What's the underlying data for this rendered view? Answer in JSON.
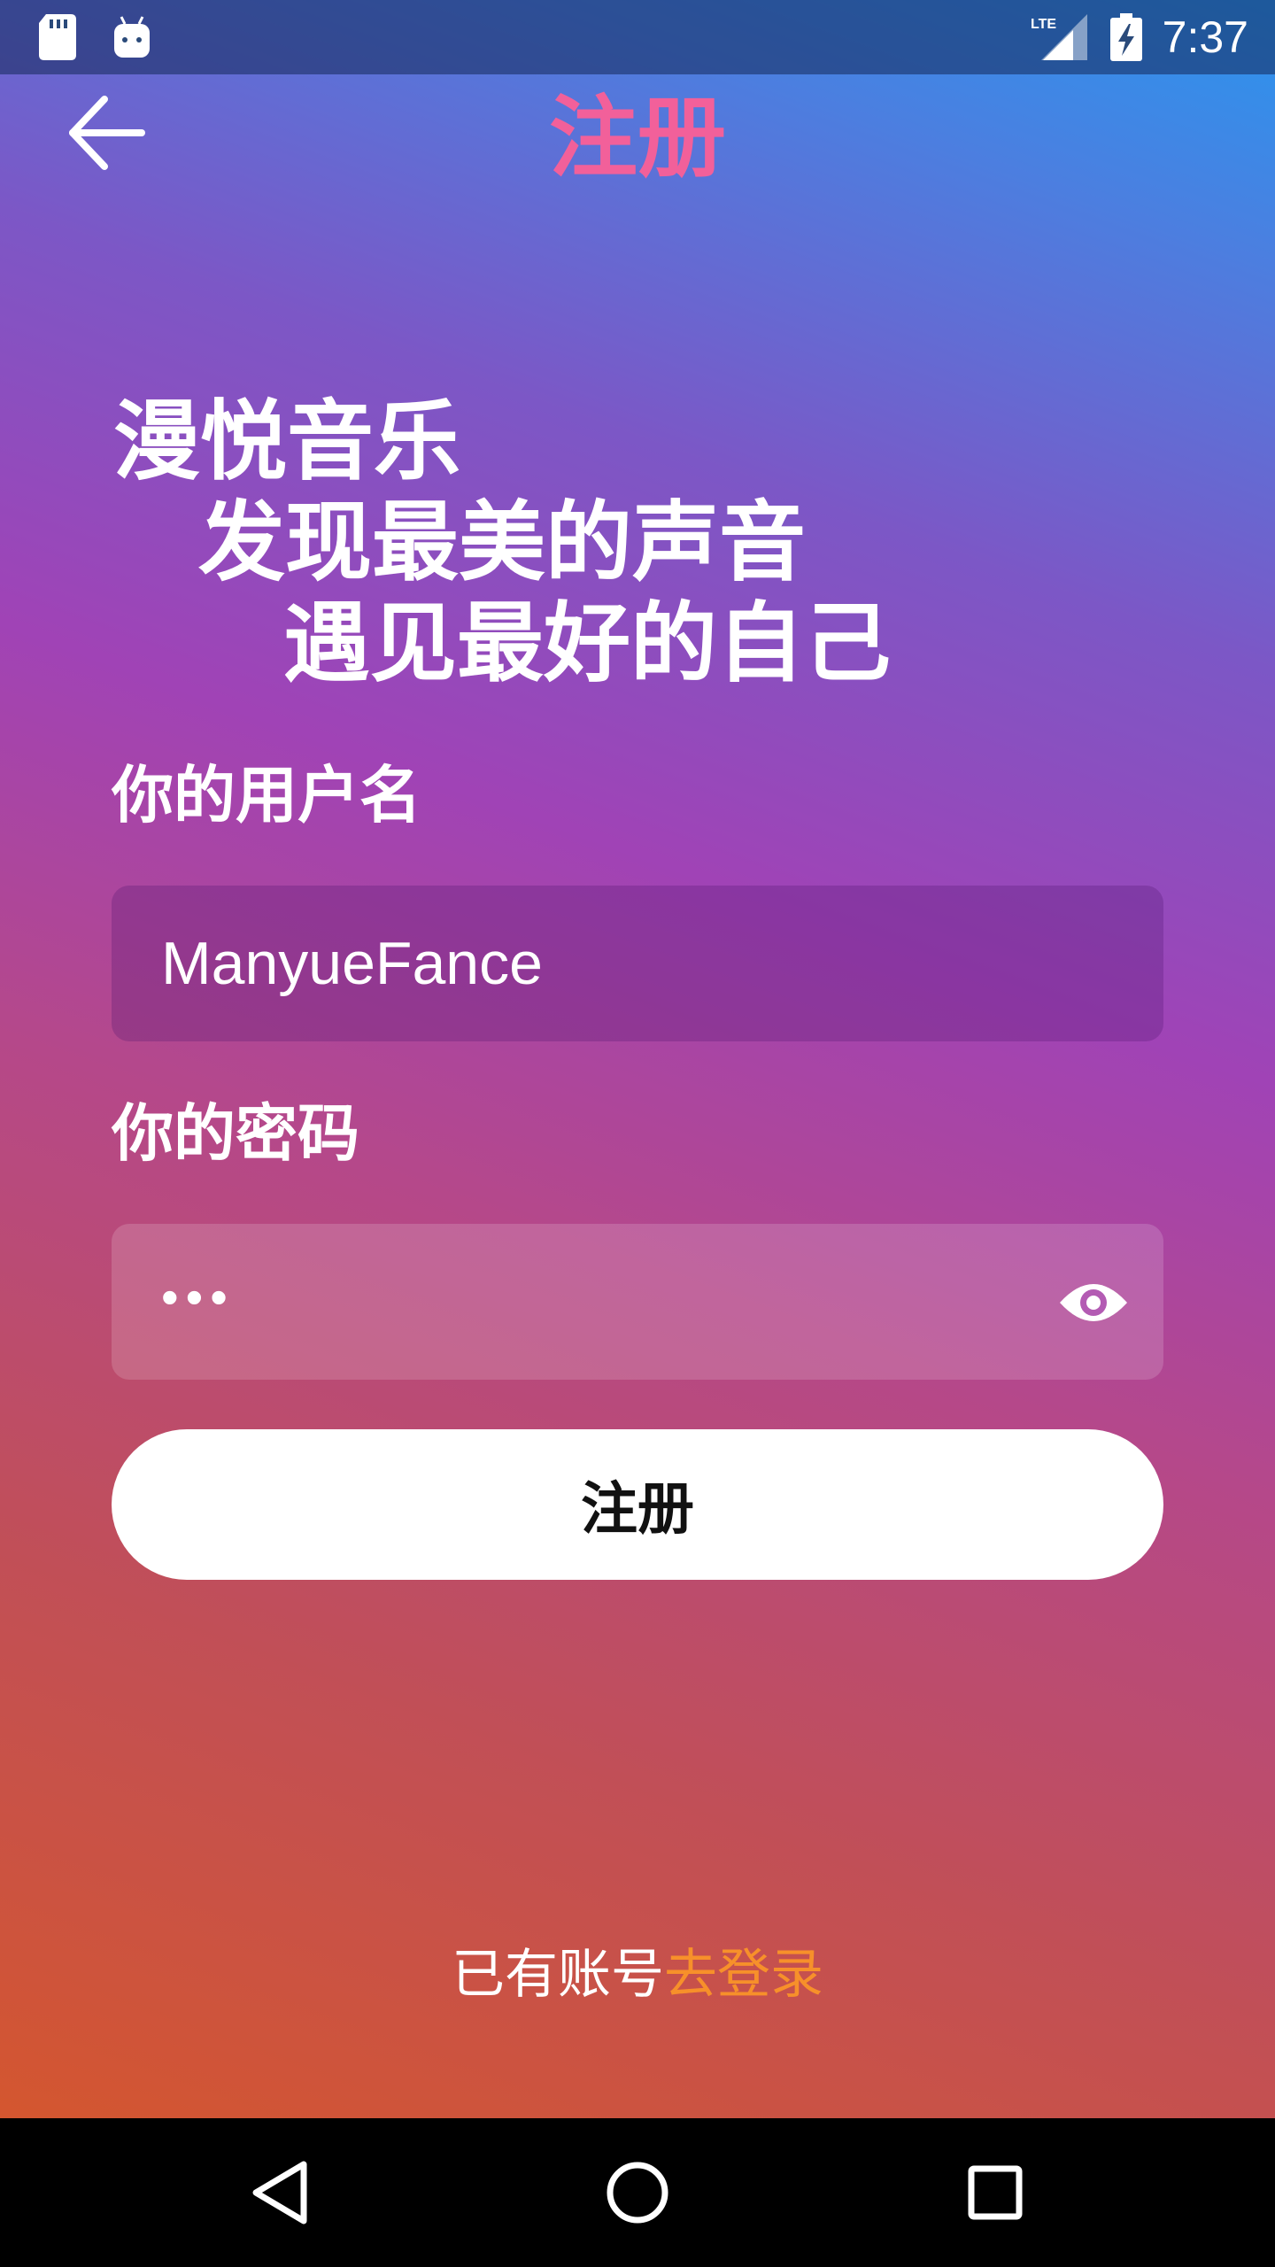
{
  "status_bar": {
    "time": "7:37",
    "network": "LTE",
    "icons": [
      "sd-card-icon",
      "android-debug-icon",
      "lte-signal-icon",
      "battery-charging-icon"
    ]
  },
  "header": {
    "title": "注册",
    "back_icon": "arrow-left-icon"
  },
  "slogan": {
    "line1": "漫悦音乐",
    "line2": "发现最美的声音",
    "line3": "遇见最好的自己"
  },
  "form": {
    "username_label": "你的用户名",
    "username_value": "ManyueFance",
    "password_label": "你的密码",
    "password_value_masked": "•••",
    "show_password_icon": "eye-icon",
    "submit_label": "注册"
  },
  "footer": {
    "prompt": "已有账号",
    "login_link": "去登录"
  },
  "nav_bar": {
    "icons": [
      "back-triangle-icon",
      "home-circle-icon",
      "recents-square-icon"
    ]
  },
  "colors": {
    "title": "#f2609a",
    "link": "#f7902a",
    "gradient_top_right": "#2a95ee",
    "gradient_middle": "#a043b6",
    "gradient_bottom_left": "#d4562f"
  }
}
